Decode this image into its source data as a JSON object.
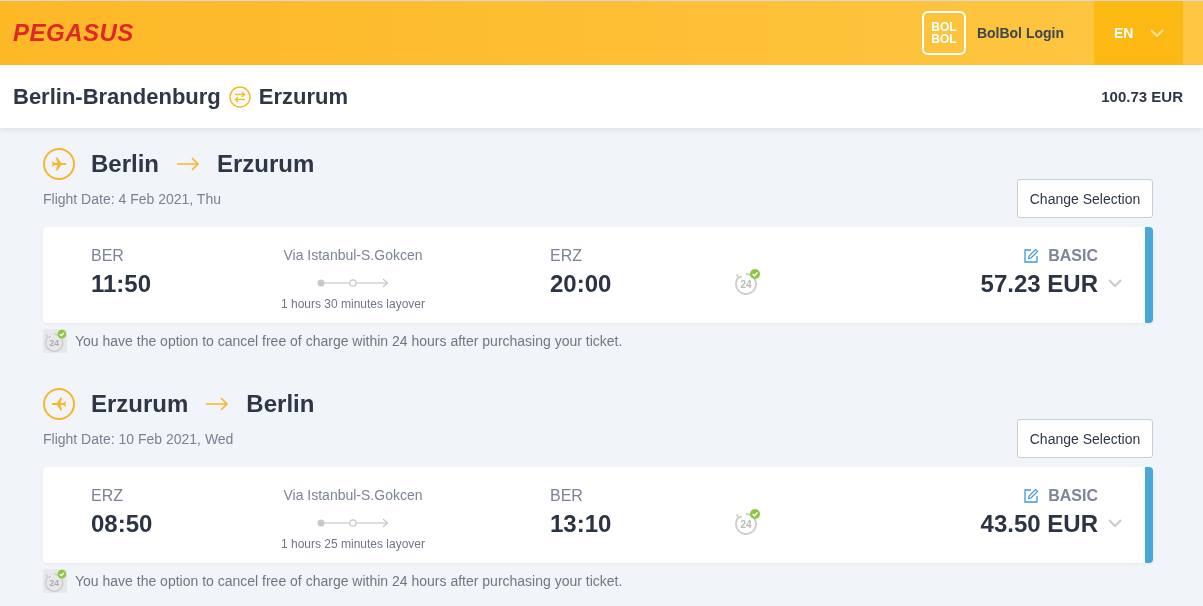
{
  "header": {
    "brand": "PEGASUS",
    "loyalty_logo": [
      "BOL",
      "BOL"
    ],
    "login": "BolBol Login",
    "language": "EN"
  },
  "summary": {
    "origin": "Berlin-Brandenburg",
    "destination": "Erzurum",
    "total": "100.73 EUR"
  },
  "flights": [
    {
      "kind": "outbound",
      "from": "Berlin",
      "to": "Erzurum",
      "date": "Flight Date: 4 Feb 2021, Thu",
      "change_button": "Change Selection",
      "card": {
        "departure_code": "BER",
        "departure_time": "11:50",
        "via": "Via Istanbul-S.Gokcen",
        "layover": "1 hours 30 minutes layover",
        "arrival_code": "ERZ",
        "arrival_time": "20:00",
        "cancel_icon_text": "24",
        "fare": "BASIC",
        "price": "57.23 EUR"
      },
      "notice": {
        "icon_text": "24",
        "text": "You have the option to cancel free of charge within 24 hours after purchasing your ticket."
      }
    },
    {
      "kind": "inbound",
      "from": "Erzurum",
      "to": "Berlin",
      "date": "Flight Date: 10 Feb 2021, Wed",
      "change_button": "Change Selection",
      "card": {
        "departure_code": "ERZ",
        "departure_time": "08:50",
        "via": "Via Istanbul-S.Gokcen",
        "layover": "1 hours 25 minutes layover",
        "arrival_code": "BER",
        "arrival_time": "13:10",
        "cancel_icon_text": "24",
        "fare": "BASIC",
        "price": "43.50 EUR"
      },
      "notice": {
        "icon_text": "24",
        "text": "You have the option to cancel free of charge within 24 hours after purchasing your ticket."
      }
    }
  ]
}
